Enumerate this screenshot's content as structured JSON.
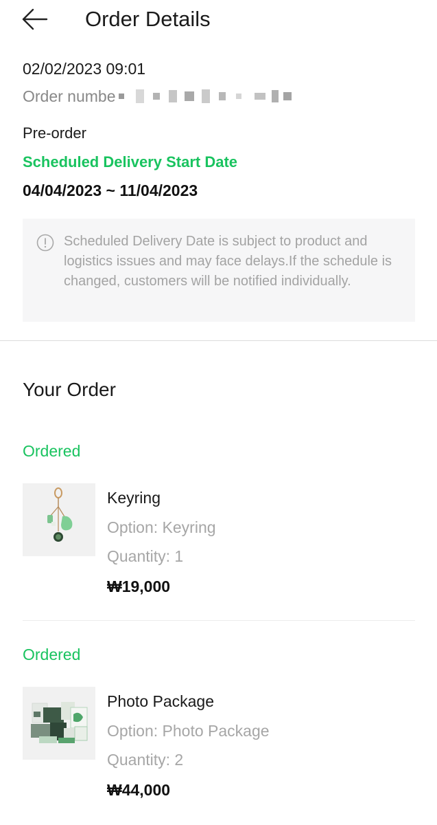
{
  "header": {
    "title": "Order Details",
    "back_icon": "arrow-left-icon"
  },
  "order": {
    "date": "02/02/2023 09:01",
    "number_label": "Order numbe",
    "type": "Pre-order",
    "delivery_heading": "Scheduled Delivery Start Date",
    "delivery_range": "04/04/2023 ~ 11/04/2023"
  },
  "notice": {
    "icon": "info-circle-icon",
    "text": "Scheduled Delivery Date is subject to product and logistics issues and may face delays.If the schedule is changed, customers will be notified individually."
  },
  "your_order": {
    "title": "Your Order",
    "items": [
      {
        "status": "Ordered",
        "name": "Keyring",
        "option": "Option: Keyring",
        "quantity": "Quantity: 1",
        "price": "₩19,000"
      },
      {
        "status": "Ordered",
        "name": "Photo Package",
        "option": "Option: Photo Package",
        "quantity": "Quantity: 2",
        "price": "₩44,000"
      }
    ]
  },
  "colors": {
    "accent_green": "#19c35f",
    "muted_text": "#a6a6a6",
    "notice_bg": "#f6f6f7"
  }
}
